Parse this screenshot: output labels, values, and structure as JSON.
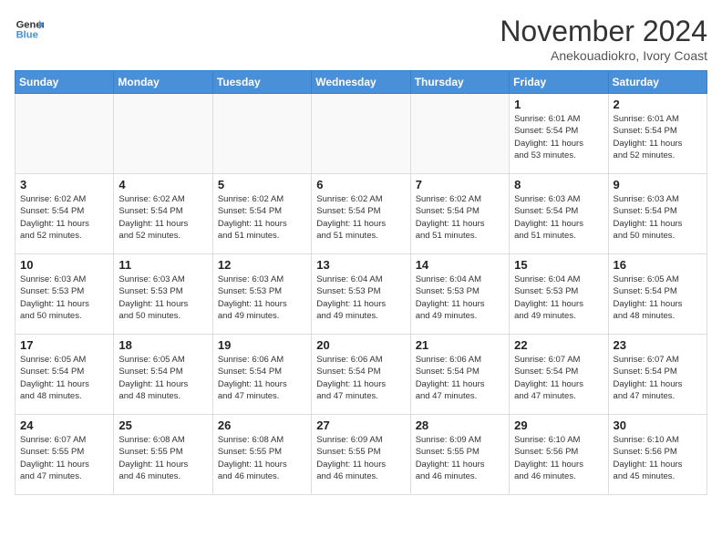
{
  "header": {
    "logo_line1": "General",
    "logo_line2": "Blue",
    "month_title": "November 2024",
    "location": "Anekouadiokro, Ivory Coast"
  },
  "weekdays": [
    "Sunday",
    "Monday",
    "Tuesday",
    "Wednesday",
    "Thursday",
    "Friday",
    "Saturday"
  ],
  "weeks": [
    [
      {
        "day": "",
        "info": ""
      },
      {
        "day": "",
        "info": ""
      },
      {
        "day": "",
        "info": ""
      },
      {
        "day": "",
        "info": ""
      },
      {
        "day": "",
        "info": ""
      },
      {
        "day": "1",
        "info": "Sunrise: 6:01 AM\nSunset: 5:54 PM\nDaylight: 11 hours\nand 53 minutes."
      },
      {
        "day": "2",
        "info": "Sunrise: 6:01 AM\nSunset: 5:54 PM\nDaylight: 11 hours\nand 52 minutes."
      }
    ],
    [
      {
        "day": "3",
        "info": "Sunrise: 6:02 AM\nSunset: 5:54 PM\nDaylight: 11 hours\nand 52 minutes."
      },
      {
        "day": "4",
        "info": "Sunrise: 6:02 AM\nSunset: 5:54 PM\nDaylight: 11 hours\nand 52 minutes."
      },
      {
        "day": "5",
        "info": "Sunrise: 6:02 AM\nSunset: 5:54 PM\nDaylight: 11 hours\nand 51 minutes."
      },
      {
        "day": "6",
        "info": "Sunrise: 6:02 AM\nSunset: 5:54 PM\nDaylight: 11 hours\nand 51 minutes."
      },
      {
        "day": "7",
        "info": "Sunrise: 6:02 AM\nSunset: 5:54 PM\nDaylight: 11 hours\nand 51 minutes."
      },
      {
        "day": "8",
        "info": "Sunrise: 6:03 AM\nSunset: 5:54 PM\nDaylight: 11 hours\nand 51 minutes."
      },
      {
        "day": "9",
        "info": "Sunrise: 6:03 AM\nSunset: 5:54 PM\nDaylight: 11 hours\nand 50 minutes."
      }
    ],
    [
      {
        "day": "10",
        "info": "Sunrise: 6:03 AM\nSunset: 5:53 PM\nDaylight: 11 hours\nand 50 minutes."
      },
      {
        "day": "11",
        "info": "Sunrise: 6:03 AM\nSunset: 5:53 PM\nDaylight: 11 hours\nand 50 minutes."
      },
      {
        "day": "12",
        "info": "Sunrise: 6:03 AM\nSunset: 5:53 PM\nDaylight: 11 hours\nand 49 minutes."
      },
      {
        "day": "13",
        "info": "Sunrise: 6:04 AM\nSunset: 5:53 PM\nDaylight: 11 hours\nand 49 minutes."
      },
      {
        "day": "14",
        "info": "Sunrise: 6:04 AM\nSunset: 5:53 PM\nDaylight: 11 hours\nand 49 minutes."
      },
      {
        "day": "15",
        "info": "Sunrise: 6:04 AM\nSunset: 5:53 PM\nDaylight: 11 hours\nand 49 minutes."
      },
      {
        "day": "16",
        "info": "Sunrise: 6:05 AM\nSunset: 5:54 PM\nDaylight: 11 hours\nand 48 minutes."
      }
    ],
    [
      {
        "day": "17",
        "info": "Sunrise: 6:05 AM\nSunset: 5:54 PM\nDaylight: 11 hours\nand 48 minutes."
      },
      {
        "day": "18",
        "info": "Sunrise: 6:05 AM\nSunset: 5:54 PM\nDaylight: 11 hours\nand 48 minutes."
      },
      {
        "day": "19",
        "info": "Sunrise: 6:06 AM\nSunset: 5:54 PM\nDaylight: 11 hours\nand 47 minutes."
      },
      {
        "day": "20",
        "info": "Sunrise: 6:06 AM\nSunset: 5:54 PM\nDaylight: 11 hours\nand 47 minutes."
      },
      {
        "day": "21",
        "info": "Sunrise: 6:06 AM\nSunset: 5:54 PM\nDaylight: 11 hours\nand 47 minutes."
      },
      {
        "day": "22",
        "info": "Sunrise: 6:07 AM\nSunset: 5:54 PM\nDaylight: 11 hours\nand 47 minutes."
      },
      {
        "day": "23",
        "info": "Sunrise: 6:07 AM\nSunset: 5:54 PM\nDaylight: 11 hours\nand 47 minutes."
      }
    ],
    [
      {
        "day": "24",
        "info": "Sunrise: 6:07 AM\nSunset: 5:55 PM\nDaylight: 11 hours\nand 47 minutes."
      },
      {
        "day": "25",
        "info": "Sunrise: 6:08 AM\nSunset: 5:55 PM\nDaylight: 11 hours\nand 46 minutes."
      },
      {
        "day": "26",
        "info": "Sunrise: 6:08 AM\nSunset: 5:55 PM\nDaylight: 11 hours\nand 46 minutes."
      },
      {
        "day": "27",
        "info": "Sunrise: 6:09 AM\nSunset: 5:55 PM\nDaylight: 11 hours\nand 46 minutes."
      },
      {
        "day": "28",
        "info": "Sunrise: 6:09 AM\nSunset: 5:55 PM\nDaylight: 11 hours\nand 46 minutes."
      },
      {
        "day": "29",
        "info": "Sunrise: 6:10 AM\nSunset: 5:56 PM\nDaylight: 11 hours\nand 46 minutes."
      },
      {
        "day": "30",
        "info": "Sunrise: 6:10 AM\nSunset: 5:56 PM\nDaylight: 11 hours\nand 45 minutes."
      }
    ]
  ]
}
